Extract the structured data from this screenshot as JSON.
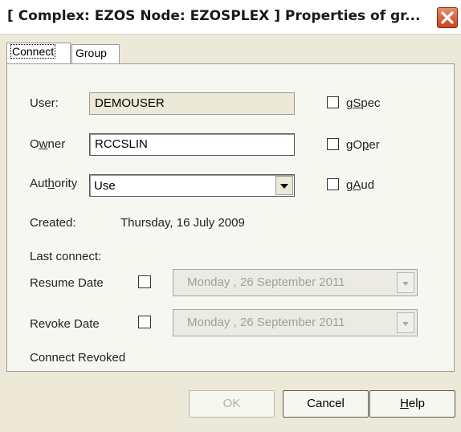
{
  "window": {
    "title": "[ Complex: EZOS Node: EZOSPLEX ] Properties of gr..."
  },
  "tabs": [
    {
      "label": "Connect",
      "active": true
    },
    {
      "label": "Group",
      "active": false
    }
  ],
  "form": {
    "user_label": "User:",
    "user_value": "DEMOUSER",
    "owner_label_pre": "O",
    "owner_label_u": "w",
    "owner_label_post": "ner",
    "owner_value": "RCCSLIN",
    "authority_label_pre": "Aut",
    "authority_label_u": "h",
    "authority_label_post": "ority",
    "authority_value": "Use",
    "gspec_pre": "g",
    "gspec_u": "S",
    "gspec_post": "pec",
    "goper_pre": "gO",
    "goper_u": "p",
    "goper_post": "er",
    "gaud_pre": "g",
    "gaud_u": "A",
    "gaud_post": "ud",
    "created_label": "Created:",
    "created_value": "Thursday, 16 July 2009",
    "last_connect_label": "Last connect:",
    "resume_label": "Resume Date",
    "resume_value": "Monday    , 26 September 2011",
    "revoke_label": "Revoke Date",
    "revoke_value": "Monday    , 26 September 2011",
    "connect_revoked": "Connect Revoked"
  },
  "buttons": {
    "ok": "OK",
    "cancel": "Cancel",
    "help_u": "H",
    "help_post": "elp"
  },
  "icons": {
    "close": "close-x-icon",
    "dropdown": "chevron-down-icon"
  },
  "colors": {
    "dialog_bg": "#ece9d8",
    "close_btn": "#c9431c"
  }
}
